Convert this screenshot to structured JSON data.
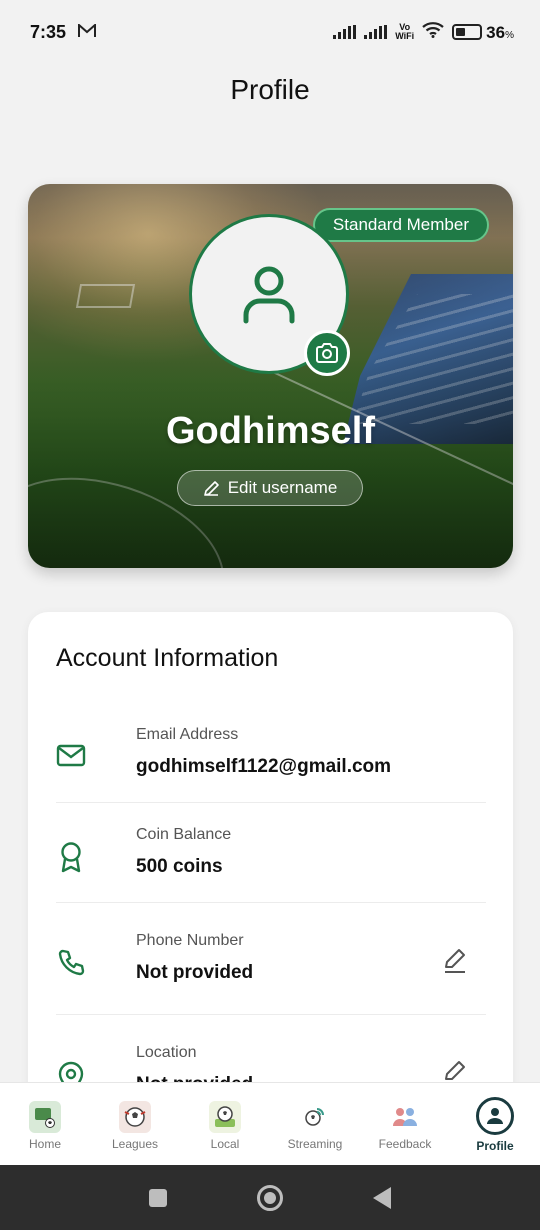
{
  "status_bar": {
    "time": "7:35",
    "vowifi_top": "Vo",
    "vowifi_bottom": "WiFi",
    "battery_level": "36",
    "battery_unit": "%"
  },
  "header": {
    "title": "Profile"
  },
  "profile": {
    "membership_badge": "Standard Member",
    "username": "Godhimself",
    "edit_username_label": "Edit username"
  },
  "account": {
    "title": "Account Information",
    "rows": [
      {
        "label": "Email Address",
        "value": "godhimself1122@gmail.com",
        "icon": "mail-icon",
        "editable": false
      },
      {
        "label": "Coin Balance",
        "value": "500 coins",
        "icon": "award-icon",
        "editable": false
      },
      {
        "label": "Phone Number",
        "value": "Not provided",
        "icon": "phone-icon",
        "editable": true
      },
      {
        "label": "Location",
        "value": "Not provided",
        "icon": "location-pin-icon",
        "editable": true
      }
    ]
  },
  "bottom_nav": {
    "items": [
      {
        "label": "Home",
        "icon": "home-scoreboard-icon"
      },
      {
        "label": "Leagues",
        "icon": "leagues-ball-icon"
      },
      {
        "label": "Local",
        "icon": "local-ball-icon"
      },
      {
        "label": "Streaming",
        "icon": "streaming-ball-icon"
      },
      {
        "label": "Feedback",
        "icon": "feedback-people-icon"
      },
      {
        "label": "Profile",
        "icon": "profile-icon"
      }
    ],
    "active": "Profile"
  },
  "colors": {
    "accent_green": "#1f7a46",
    "active_nav": "#1a3b3f",
    "background": "#f2f2f2"
  }
}
